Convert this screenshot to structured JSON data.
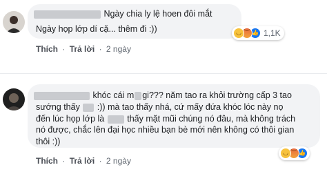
{
  "comments": [
    {
      "lines": [
        {
          "after_blur": "Ngày chia ly lệ hoen đôi mắt"
        },
        {
          "text": "Ngày họp lớp dí cặ... thêm đi :))"
        }
      ],
      "reaction_count": "1,1K",
      "actions": {
        "like": "Thích",
        "reply": "Trả lời",
        "time": "2 ngày"
      }
    },
    {
      "line1": {
        "before": "",
        "mid": "khóc cái m",
        "after": "gi??? năm tao ra khỏi trường cấp 3 tao"
      },
      "line2": {
        "before": "sướng thấy",
        "after": ":)) mà tao thấy nhá, cứ mấy đứa khóc lóc này nọ"
      },
      "line3": {
        "before": "đến lúc họp lớp là",
        "after": "thấy mặt mũi chúng nó đâu, mà không trách"
      },
      "line4": "nó được, chắc lên đại học nhiều bạn bè mới nên không có thôi gian",
      "line5": "thôi :))",
      "actions": {
        "like": "Thích",
        "reply": "Trả lời",
        "time": "2 ngày"
      }
    }
  ],
  "icons": [
    "haha-icon",
    "angry-icon",
    "like-icon"
  ],
  "colors": {
    "bubble": "#f2f3f5",
    "text": "#1c1e21",
    "meta": "#606770",
    "like": "#1877f2"
  }
}
